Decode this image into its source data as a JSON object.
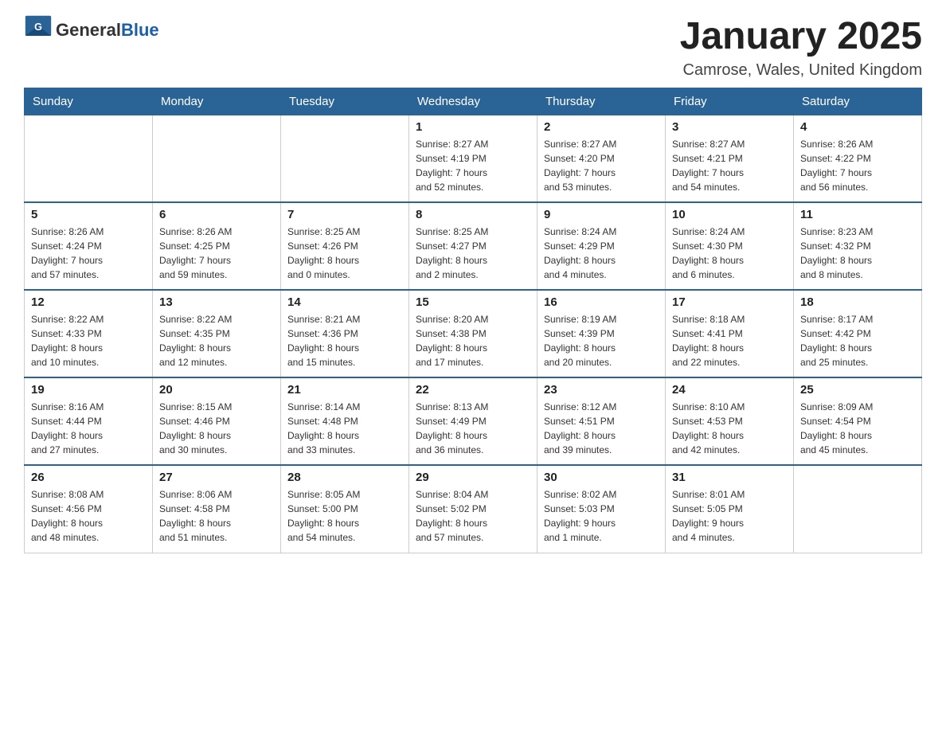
{
  "header": {
    "logo_text_general": "General",
    "logo_text_blue": "Blue",
    "month_title": "January 2025",
    "location": "Camrose, Wales, United Kingdom"
  },
  "days_of_week": [
    "Sunday",
    "Monday",
    "Tuesday",
    "Wednesday",
    "Thursday",
    "Friday",
    "Saturday"
  ],
  "weeks": [
    [
      {
        "day": "",
        "info": ""
      },
      {
        "day": "",
        "info": ""
      },
      {
        "day": "",
        "info": ""
      },
      {
        "day": "1",
        "info": "Sunrise: 8:27 AM\nSunset: 4:19 PM\nDaylight: 7 hours\nand 52 minutes."
      },
      {
        "day": "2",
        "info": "Sunrise: 8:27 AM\nSunset: 4:20 PM\nDaylight: 7 hours\nand 53 minutes."
      },
      {
        "day": "3",
        "info": "Sunrise: 8:27 AM\nSunset: 4:21 PM\nDaylight: 7 hours\nand 54 minutes."
      },
      {
        "day": "4",
        "info": "Sunrise: 8:26 AM\nSunset: 4:22 PM\nDaylight: 7 hours\nand 56 minutes."
      }
    ],
    [
      {
        "day": "5",
        "info": "Sunrise: 8:26 AM\nSunset: 4:24 PM\nDaylight: 7 hours\nand 57 minutes."
      },
      {
        "day": "6",
        "info": "Sunrise: 8:26 AM\nSunset: 4:25 PM\nDaylight: 7 hours\nand 59 minutes."
      },
      {
        "day": "7",
        "info": "Sunrise: 8:25 AM\nSunset: 4:26 PM\nDaylight: 8 hours\nand 0 minutes."
      },
      {
        "day": "8",
        "info": "Sunrise: 8:25 AM\nSunset: 4:27 PM\nDaylight: 8 hours\nand 2 minutes."
      },
      {
        "day": "9",
        "info": "Sunrise: 8:24 AM\nSunset: 4:29 PM\nDaylight: 8 hours\nand 4 minutes."
      },
      {
        "day": "10",
        "info": "Sunrise: 8:24 AM\nSunset: 4:30 PM\nDaylight: 8 hours\nand 6 minutes."
      },
      {
        "day": "11",
        "info": "Sunrise: 8:23 AM\nSunset: 4:32 PM\nDaylight: 8 hours\nand 8 minutes."
      }
    ],
    [
      {
        "day": "12",
        "info": "Sunrise: 8:22 AM\nSunset: 4:33 PM\nDaylight: 8 hours\nand 10 minutes."
      },
      {
        "day": "13",
        "info": "Sunrise: 8:22 AM\nSunset: 4:35 PM\nDaylight: 8 hours\nand 12 minutes."
      },
      {
        "day": "14",
        "info": "Sunrise: 8:21 AM\nSunset: 4:36 PM\nDaylight: 8 hours\nand 15 minutes."
      },
      {
        "day": "15",
        "info": "Sunrise: 8:20 AM\nSunset: 4:38 PM\nDaylight: 8 hours\nand 17 minutes."
      },
      {
        "day": "16",
        "info": "Sunrise: 8:19 AM\nSunset: 4:39 PM\nDaylight: 8 hours\nand 20 minutes."
      },
      {
        "day": "17",
        "info": "Sunrise: 8:18 AM\nSunset: 4:41 PM\nDaylight: 8 hours\nand 22 minutes."
      },
      {
        "day": "18",
        "info": "Sunrise: 8:17 AM\nSunset: 4:42 PM\nDaylight: 8 hours\nand 25 minutes."
      }
    ],
    [
      {
        "day": "19",
        "info": "Sunrise: 8:16 AM\nSunset: 4:44 PM\nDaylight: 8 hours\nand 27 minutes."
      },
      {
        "day": "20",
        "info": "Sunrise: 8:15 AM\nSunset: 4:46 PM\nDaylight: 8 hours\nand 30 minutes."
      },
      {
        "day": "21",
        "info": "Sunrise: 8:14 AM\nSunset: 4:48 PM\nDaylight: 8 hours\nand 33 minutes."
      },
      {
        "day": "22",
        "info": "Sunrise: 8:13 AM\nSunset: 4:49 PM\nDaylight: 8 hours\nand 36 minutes."
      },
      {
        "day": "23",
        "info": "Sunrise: 8:12 AM\nSunset: 4:51 PM\nDaylight: 8 hours\nand 39 minutes."
      },
      {
        "day": "24",
        "info": "Sunrise: 8:10 AM\nSunset: 4:53 PM\nDaylight: 8 hours\nand 42 minutes."
      },
      {
        "day": "25",
        "info": "Sunrise: 8:09 AM\nSunset: 4:54 PM\nDaylight: 8 hours\nand 45 minutes."
      }
    ],
    [
      {
        "day": "26",
        "info": "Sunrise: 8:08 AM\nSunset: 4:56 PM\nDaylight: 8 hours\nand 48 minutes."
      },
      {
        "day": "27",
        "info": "Sunrise: 8:06 AM\nSunset: 4:58 PM\nDaylight: 8 hours\nand 51 minutes."
      },
      {
        "day": "28",
        "info": "Sunrise: 8:05 AM\nSunset: 5:00 PM\nDaylight: 8 hours\nand 54 minutes."
      },
      {
        "day": "29",
        "info": "Sunrise: 8:04 AM\nSunset: 5:02 PM\nDaylight: 8 hours\nand 57 minutes."
      },
      {
        "day": "30",
        "info": "Sunrise: 8:02 AM\nSunset: 5:03 PM\nDaylight: 9 hours\nand 1 minute."
      },
      {
        "day": "31",
        "info": "Sunrise: 8:01 AM\nSunset: 5:05 PM\nDaylight: 9 hours\nand 4 minutes."
      },
      {
        "day": "",
        "info": ""
      }
    ]
  ],
  "colors": {
    "header_bg": "#2a6496",
    "header_text": "#ffffff",
    "border": "#cccccc"
  }
}
